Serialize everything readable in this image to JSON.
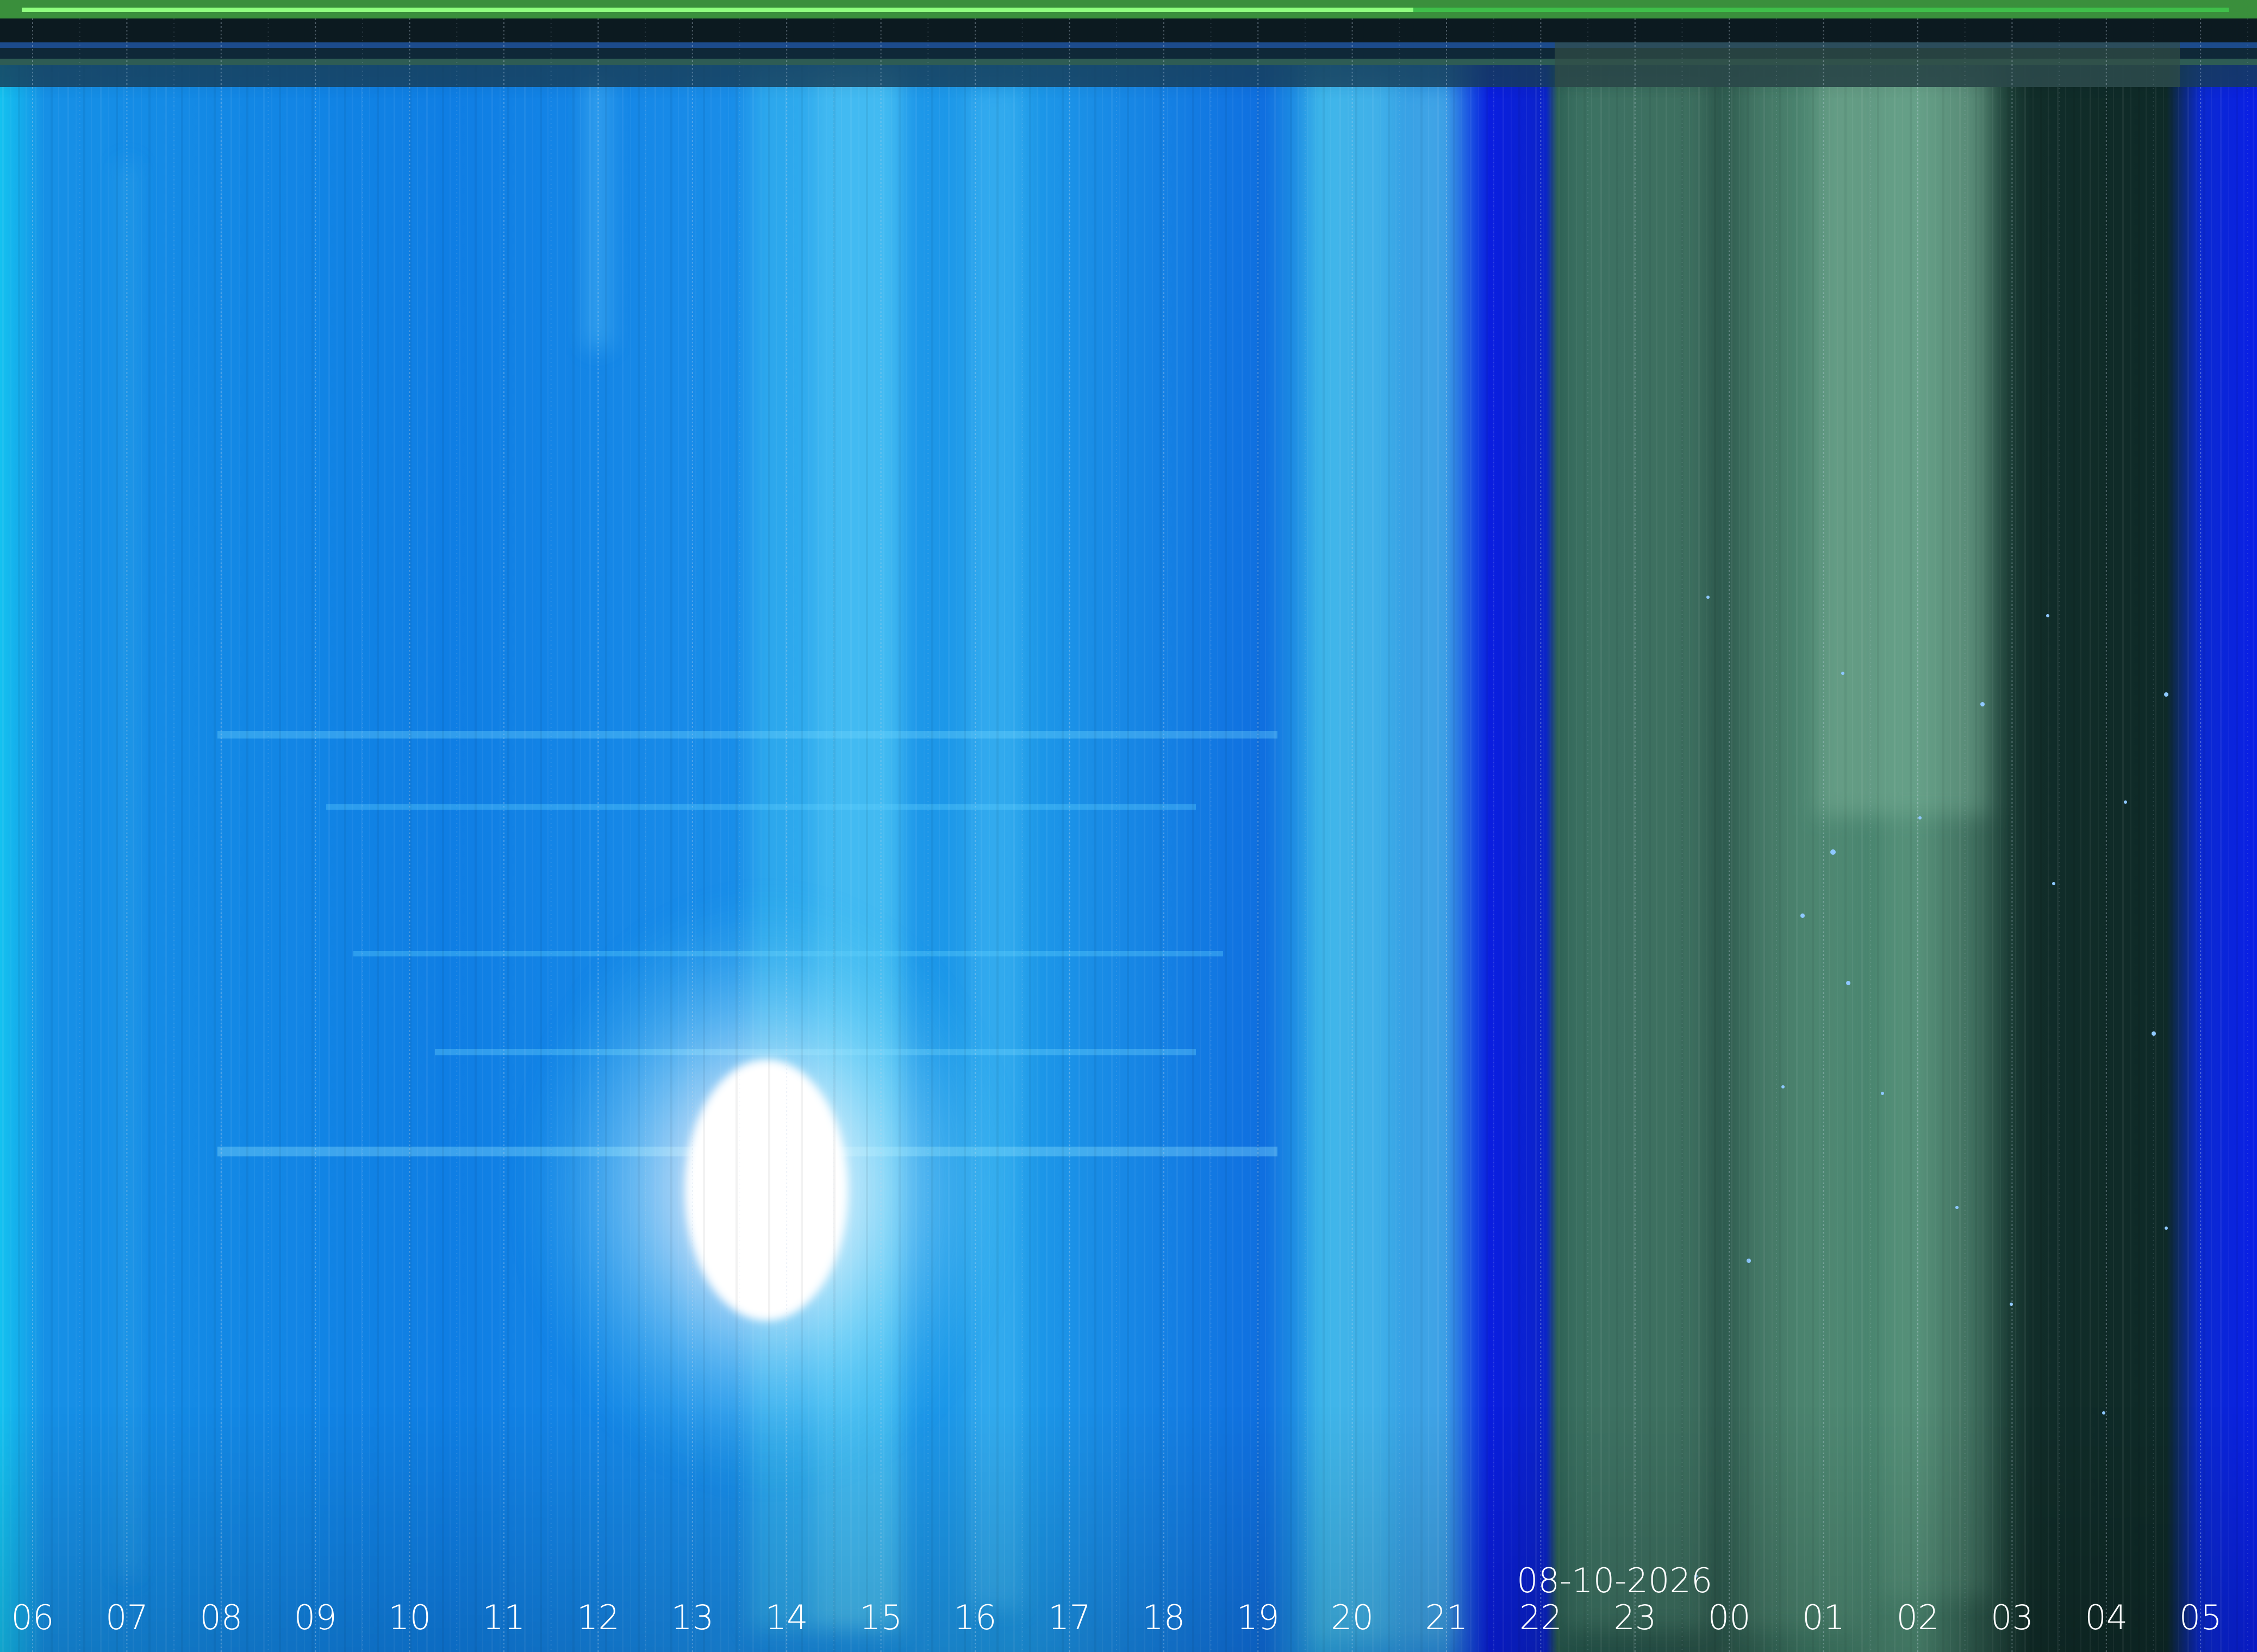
{
  "image": {
    "kind": "keogram",
    "date_label": "08-10-2026",
    "hour_labels": [
      "06",
      "07",
      "08",
      "09",
      "10",
      "11",
      "12",
      "13",
      "14",
      "15",
      "16",
      "17",
      "18",
      "19",
      "20",
      "21",
      "22",
      "23",
      "00",
      "01",
      "02",
      "03",
      "04",
      "05"
    ],
    "colors": {
      "day_sky": "#1a8fe8",
      "day_sky_deep": "#0a55d8",
      "twilight_band": "#0a1ee0",
      "night_sky": "#0f2a26",
      "night_cloud": "#4f8a73",
      "sun_glow": "#ffffff",
      "top_strip": "#3fbf4a",
      "gridline": "#c8d8e8",
      "label_text": "#ffffff"
    }
  }
}
